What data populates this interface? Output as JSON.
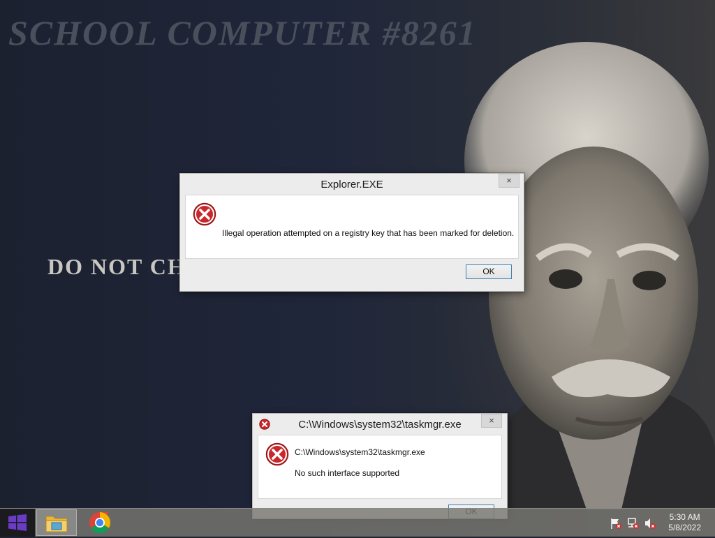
{
  "desktop": {
    "title": "SCHOOL COMPUTER #8261",
    "subtitle": "DO NOT CHA"
  },
  "dialogs": [
    {
      "title": "Explorer.EXE",
      "close_label": "×",
      "message": "Illegal operation attempted on a registry key that has been marked for deletion.",
      "ok_label": "OK",
      "icon": "error-icon"
    },
    {
      "title": "C:\\Windows\\system32\\taskmgr.exe",
      "close_label": "×",
      "message_line1": "C:\\Windows\\system32\\taskmgr.exe",
      "message_line2": "No such interface supported",
      "ok_label": "OK",
      "icon": "error-icon"
    }
  ],
  "taskbar": {
    "pinned": [
      "file-explorer-icon",
      "chrome-icon"
    ],
    "tray": [
      "action-center-flag-icon",
      "network-icon",
      "volume-muted-icon"
    ],
    "time": "5:30 AM",
    "date": "5/8/2022"
  },
  "colors": {
    "error_red": "#c8282c",
    "accent_blue": "#3c7fb1",
    "taskbar": "#787670",
    "start": "#5b2a9e"
  }
}
